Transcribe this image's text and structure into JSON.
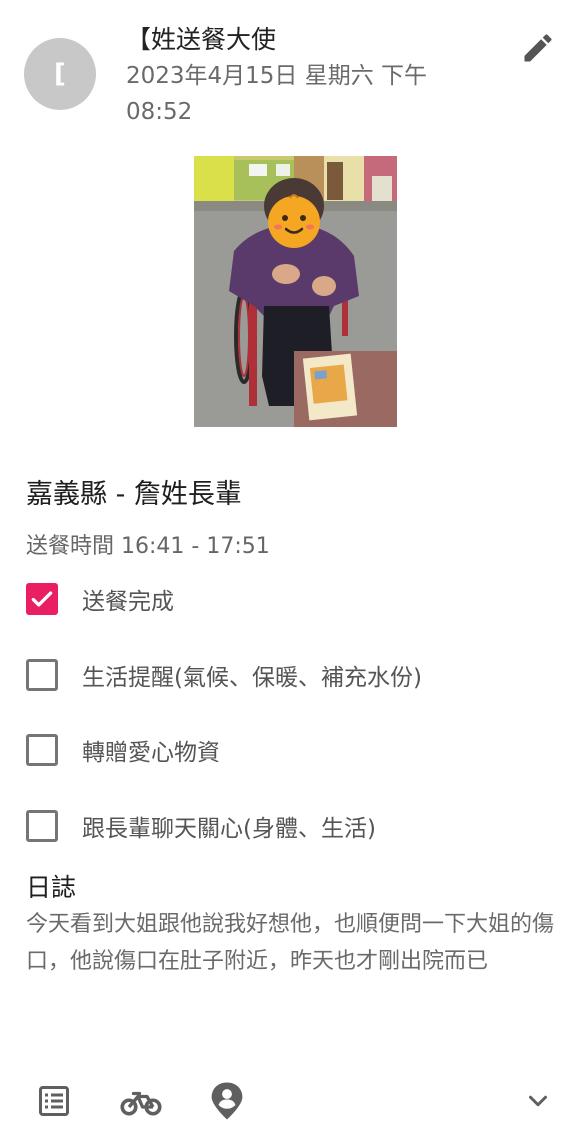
{
  "header": {
    "avatar_initial": "[",
    "author": "【姓送餐大使",
    "timestamp": "2023年4月15日 星期六 下午 08:52",
    "edit_icon": "pencil-icon"
  },
  "post": {
    "title": "嘉義縣 - 詹姓長輩",
    "time_range": "送餐時間 16:41 - 17:51",
    "checklist": [
      {
        "label": "送餐完成",
        "checked": true
      },
      {
        "label": "生活提醒(氣候、保暖、補充水份)",
        "checked": false
      },
      {
        "label": "轉贈愛心物資",
        "checked": false
      },
      {
        "label": "跟長輩聊天關心(身體、生活)",
        "checked": false
      }
    ],
    "log_title": "日誌",
    "log_body": "今天看到大姐跟他說我好想他，也順便問一下大姐的傷口，他說傷口在肚子附近，昨天也才剛出院而已"
  },
  "bottom_bar": {
    "icons": [
      "list-icon",
      "bicycle-icon",
      "person-pin-icon",
      "chevron-down-icon"
    ]
  },
  "colors": {
    "accent": "#e91e63",
    "avatar_bg": "#c8c8c8",
    "secondary_text": "#6a6a6a"
  }
}
